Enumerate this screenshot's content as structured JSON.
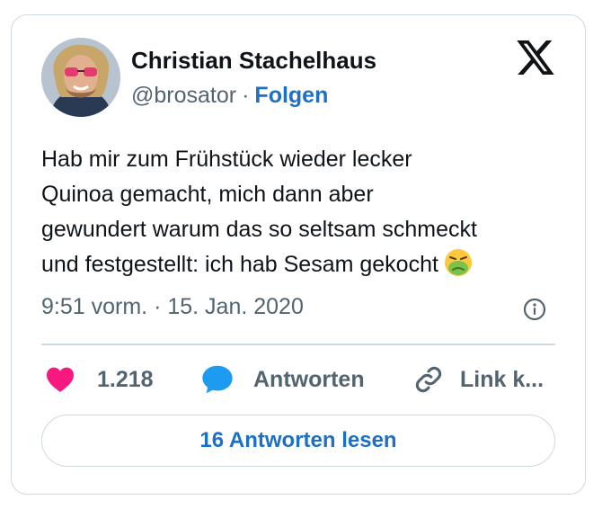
{
  "author": {
    "name": "Christian Stachelhaus",
    "handle": "@brosator",
    "separator": "·",
    "follow_label": "Folgen"
  },
  "tweet": {
    "lines": [
      "Hab mir zum Frühstück wieder lecker",
      "Quinoa gemacht, mich dann aber",
      "gewundert warum das so seltsam schmeckt",
      "und festgestellt: ich hab Sesam gekocht"
    ],
    "emoji": "nauseated-face-icon"
  },
  "meta": {
    "time": "9:51 vorm.",
    "separator": "·",
    "date": "15. Jan. 2020"
  },
  "actions": {
    "likes": "1.218",
    "reply_label": "Antworten",
    "link_label": "Link k..."
  },
  "read_replies_label": "16 Antworten lesen",
  "colors": {
    "accent_blue": "#1d70c4",
    "like_pink": "#f91880",
    "reply_blue": "#1d9bf0",
    "secondary_text": "#536471",
    "border": "#cfd9de"
  }
}
